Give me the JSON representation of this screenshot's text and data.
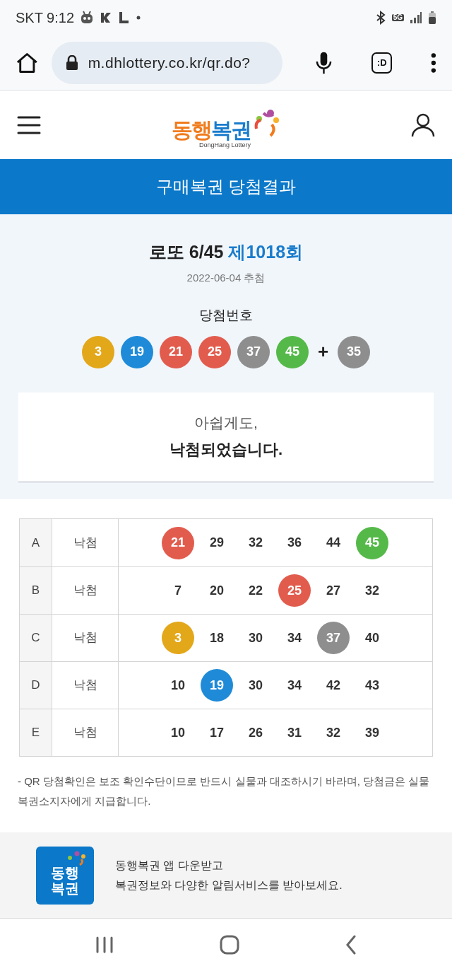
{
  "status_bar": {
    "carrier_time": "SKT 9:12",
    "network": "5G"
  },
  "browser": {
    "url": "m.dhlottery.co.kr/qr.do?",
    "tab_label": ":D"
  },
  "header": {
    "logo_text_1": "동행",
    "logo_text_2": "복권",
    "logo_subtitle": "DongHang Lottery"
  },
  "banner": {
    "title": "구매복권 당첨결과"
  },
  "draw": {
    "game": "로또 6/45",
    "round": "제1018회",
    "date": "2022-06-04 추첨",
    "winning_label": "당첨번호",
    "numbers": [
      {
        "value": "3",
        "color": "#e3a71a"
      },
      {
        "value": "19",
        "color": "#1f8bd8"
      },
      {
        "value": "21",
        "color": "#e25c4e"
      },
      {
        "value": "25",
        "color": "#e25c4e"
      },
      {
        "value": "37",
        "color": "#8e8e8e"
      },
      {
        "value": "45",
        "color": "#55b949"
      }
    ],
    "plus": "+",
    "bonus": {
      "value": "35",
      "color": "#8e8e8e"
    }
  },
  "result": {
    "line_1": "아쉽게도,",
    "line_2": "낙첨되었습니다."
  },
  "tickets": [
    {
      "label": "A",
      "status": "낙첨",
      "numbers": [
        {
          "value": "21",
          "color": "#e25c4e"
        },
        {
          "value": "29"
        },
        {
          "value": "32"
        },
        {
          "value": "36"
        },
        {
          "value": "44"
        },
        {
          "value": "45",
          "color": "#55b949"
        }
      ]
    },
    {
      "label": "B",
      "status": "낙첨",
      "numbers": [
        {
          "value": "7"
        },
        {
          "value": "20"
        },
        {
          "value": "22"
        },
        {
          "value": "25",
          "color": "#e25c4e"
        },
        {
          "value": "27"
        },
        {
          "value": "32"
        }
      ]
    },
    {
      "label": "C",
      "status": "낙첨",
      "numbers": [
        {
          "value": "3",
          "color": "#e3a71a"
        },
        {
          "value": "18"
        },
        {
          "value": "30"
        },
        {
          "value": "34"
        },
        {
          "value": "37",
          "color": "#8e8e8e"
        },
        {
          "value": "40"
        }
      ]
    },
    {
      "label": "D",
      "status": "낙첨",
      "numbers": [
        {
          "value": "10"
        },
        {
          "value": "19",
          "color": "#1f8bd8"
        },
        {
          "value": "30"
        },
        {
          "value": "34"
        },
        {
          "value": "42"
        },
        {
          "value": "43"
        }
      ]
    },
    {
      "label": "E",
      "status": "낙첨",
      "numbers": [
        {
          "value": "10"
        },
        {
          "value": "17"
        },
        {
          "value": "26"
        },
        {
          "value": "31"
        },
        {
          "value": "32"
        },
        {
          "value": "39"
        }
      ]
    }
  ],
  "notice": "- QR 당첨확인은 보조 확인수단이므로 반드시 실물과 대조하시기 바라며, 당첨금은 실물 복권소지자에게 지급합니다.",
  "app_promo": {
    "icon_text": "동행복권",
    "line_1": "동행복권 앱 다운받고",
    "line_2": "복권정보와 다양한 알림서비스를 받아보세요."
  }
}
